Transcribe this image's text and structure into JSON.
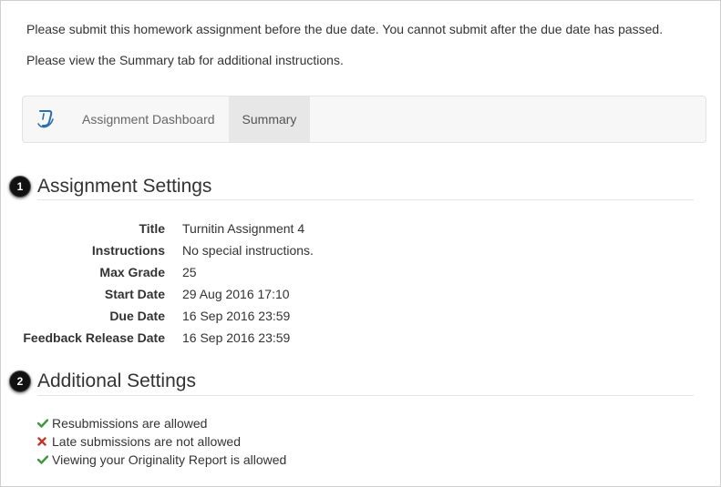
{
  "intro": {
    "line1": "Please submit this homework assignment before the due date. You cannot submit after the due date has passed.",
    "line2": "Please view the Summary tab for additional instructions."
  },
  "nav": {
    "logo_icon": "turnitin-logo-icon",
    "tabs": [
      {
        "label": "Assignment Dashboard",
        "active": false
      },
      {
        "label": "Summary",
        "active": true
      }
    ]
  },
  "assignment_settings": {
    "badge": "1",
    "title": "Assignment Settings",
    "rows": [
      {
        "label": "Title",
        "value": "Turnitin Assignment 4"
      },
      {
        "label": "Instructions",
        "value": "No special instructions."
      },
      {
        "label": "Max Grade",
        "value": "25"
      },
      {
        "label": "Start Date",
        "value": "29 Aug 2016 17:10"
      },
      {
        "label": "Due Date",
        "value": "16 Sep 2016 23:59"
      },
      {
        "label": "Feedback Release Date",
        "value": "16 Sep 2016 23:59"
      }
    ]
  },
  "additional_settings": {
    "badge": "2",
    "title": "Additional Settings",
    "items": [
      {
        "icon": "check-icon",
        "text": "Resubmissions are allowed"
      },
      {
        "icon": "cross-icon",
        "text": "Late submissions are not allowed"
      },
      {
        "icon": "check-icon",
        "text": "Viewing your Originality Report is allowed"
      }
    ]
  },
  "colors": {
    "check": "#3c9a3c",
    "cross": "#c0392b",
    "logo": "#2a6fb0"
  }
}
